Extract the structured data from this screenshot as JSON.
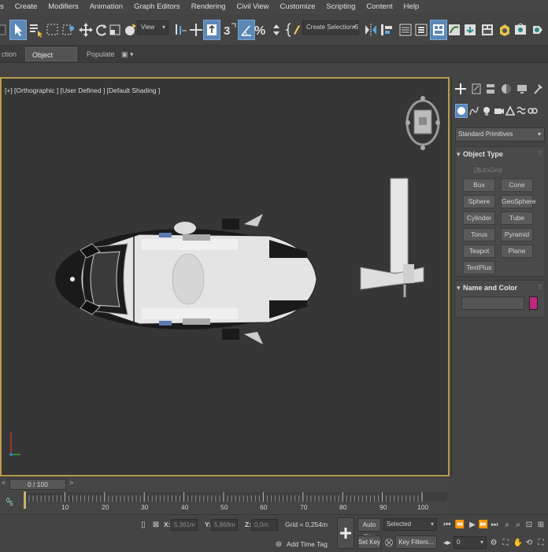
{
  "menu": [
    "s",
    "Create",
    "Modifiers",
    "Animation",
    "Graph Editors",
    "Rendering",
    "Civil View",
    "Customize",
    "Scripting",
    "Content",
    "Help"
  ],
  "toolbar": {
    "view_combo": "View",
    "selection_set": "Create Selection Se",
    "percent_symbol": "%",
    "three_label": "3"
  },
  "ribbon": {
    "tabs": [
      "ction",
      "Object Paint",
      "Populate"
    ],
    "active_tab": "Object Paint"
  },
  "viewport": {
    "label": "[+] [Orthographic ] [User Defined ] [Default Shading ]"
  },
  "command_panel": {
    "primitives_dropdown": "Standard Primitives",
    "object_type_title": "Object Type",
    "autogrid_label": "AutoGrid",
    "buttons": [
      "Box",
      "Cone",
      "Sphere",
      "GeoSphere",
      "Cylinder",
      "Tube",
      "Torus",
      "Pyramid",
      "Teapot",
      "Plane",
      "TextPlus"
    ],
    "name_color_title": "Name and Color",
    "swatch_color": "#c2277e"
  },
  "timeline": {
    "frame_display": "0 / 100",
    "ticks": [
      "10",
      "20",
      "30",
      "40",
      "50",
      "60",
      "70",
      "80",
      "90",
      "100"
    ],
    "left_labels": [
      "0",
      "5"
    ]
  },
  "status": {
    "x_label": "X:",
    "x_value": "5,361m",
    "y_label": "Y:",
    "y_value": "5,868m",
    "z_label": "Z:",
    "z_value": "0,0m",
    "grid": "Grid = 0,254m",
    "add_time_tag": "Add Time Tag",
    "auto_key": "Auto Key",
    "selected": "Selected",
    "set_key": "Set Key",
    "key_filters": "Key Filters...",
    "frame_value": "0"
  },
  "colors": {
    "viewport_border": "#b89b4a",
    "active_blue": "#5c88b8",
    "swatch": "#c2277e"
  }
}
